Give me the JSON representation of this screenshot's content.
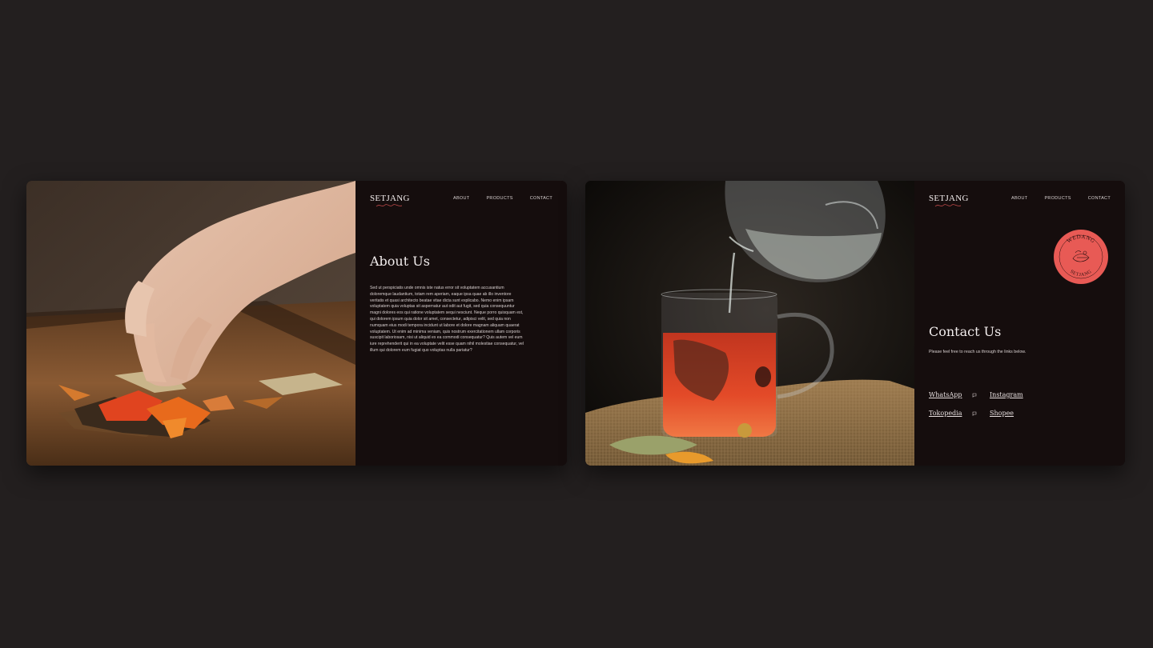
{
  "nav": {
    "about": "ABOUT",
    "products": "PRODUCTS",
    "contact": "CONTACT"
  },
  "brand": {
    "name": "SETJANG"
  },
  "about_page": {
    "heading": "About Us",
    "body": "Sed ut perspiciatis unde omnis iste natus error sit voluptatem accusantium doloremque laudantium, totam rem aperiam, eaque ipsa quae ab illo inventore veritatis et quasi architecto beatae vitae dicta sunt explicabo. Nemo enim ipsam voluptatem quia voluptas sit aspernatur aut odit aut fugit, sed quia consequuntur magni dolores eos qui ratione voluptatem sequi nesciunt. Neque porro quisquam est, qui dolorem ipsum quia dolor sit amet, consectetur, adipisci velit, sed quia non numquam eius modi tempora incidunt ut labore et dolore magnam aliquam quaerat voluptatem. Ut enim ad minima veniam, quis nostrum exercitationem ullam corporis suscipit laboriosam, nisi ut aliquid ex ea commodi consequatur? Quis autem vel eum iure reprehenderit qui in ea voluptate velit esse quam nihil molestiae consequatur, vel illum qui dolorem eum fugiat quo voluptas nulla pariatur?"
  },
  "contact_page": {
    "heading": "Contact Us",
    "subtext": "Please feel free to reach us through the links below.",
    "links": [
      "WhatsApp",
      "Instagram",
      "Tokopedia",
      "Shopee"
    ],
    "badge": {
      "top_text": "WEDANG",
      "bottom_text": "SETJANG"
    }
  },
  "colors": {
    "background": "#231f1f",
    "panel": "#150d0d",
    "accent": "#e85a55"
  }
}
